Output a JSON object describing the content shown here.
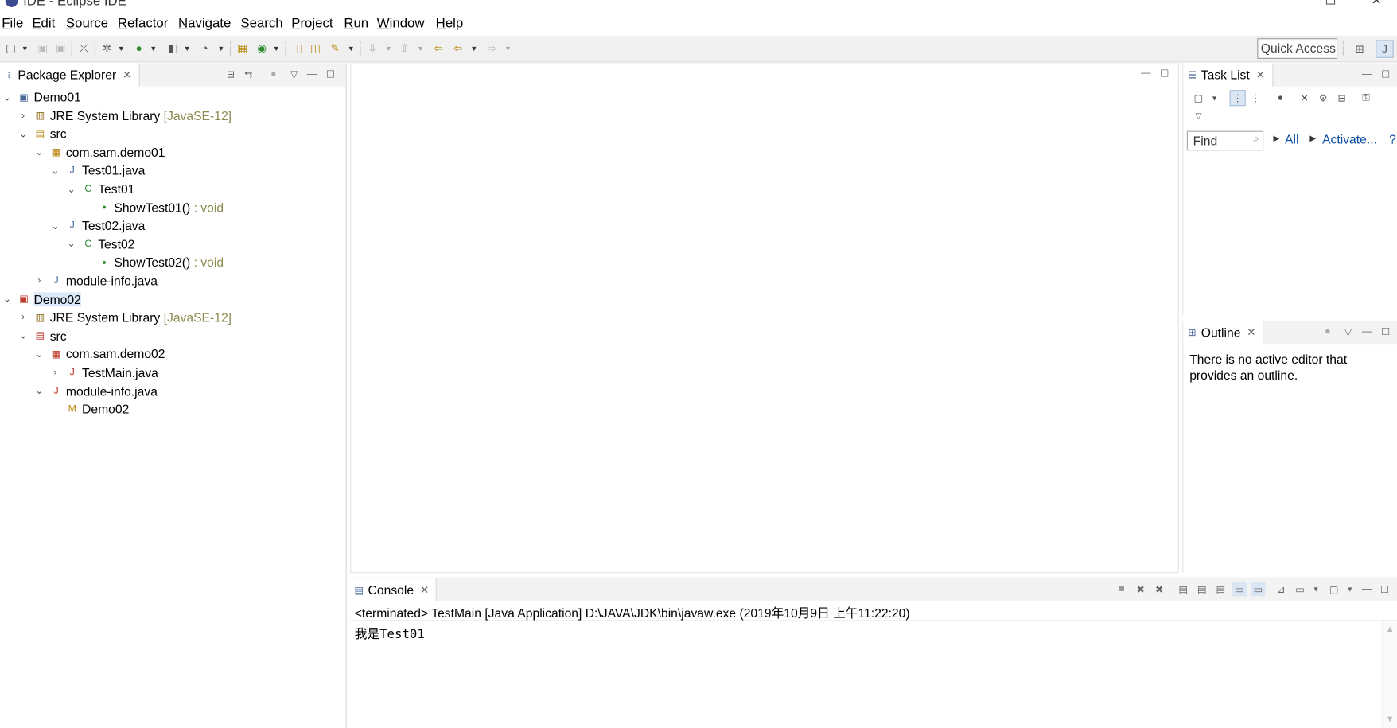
{
  "window": {
    "title": "IDE - Eclipse IDE"
  },
  "menu": [
    "File",
    "Edit",
    "Source",
    "Refactor",
    "Navigate",
    "Search",
    "Project",
    "Run",
    "Window",
    "Help"
  ],
  "toolbar": {
    "quick_access": "Quick Access"
  },
  "package_explorer": {
    "title": "Package Explorer",
    "rows": [
      {
        "label": "Demo01",
        "deco": "",
        "expand": "expanded",
        "icon": "project-icon"
      },
      {
        "label": "JRE System Library",
        "deco": " [JavaSE-12]",
        "expand": "collapsed",
        "icon": "library-icon"
      },
      {
        "label": "src",
        "deco": "",
        "expand": "expanded",
        "icon": "source-folder-icon"
      },
      {
        "label": "com.sam.demo01",
        "deco": "",
        "expand": "expanded",
        "icon": "package-icon"
      },
      {
        "label": "Test01.java",
        "deco": "",
        "expand": "expanded",
        "icon": "java-file-icon"
      },
      {
        "label": "Test01",
        "deco": "",
        "expand": "expanded",
        "icon": "class-icon"
      },
      {
        "label": "ShowTest01()",
        "deco": " : void",
        "expand": "none",
        "icon": "method-icon"
      },
      {
        "label": "Test02.java",
        "deco": "",
        "expand": "expanded",
        "icon": "java-file-icon"
      },
      {
        "label": "Test02",
        "deco": "",
        "expand": "expanded",
        "icon": "class-icon"
      },
      {
        "label": "ShowTest02()",
        "deco": " : void",
        "expand": "none",
        "icon": "method-icon"
      },
      {
        "label": "module-info.java",
        "deco": "",
        "expand": "collapsed",
        "icon": "java-file-icon"
      },
      {
        "label": "Demo02",
        "deco": "",
        "expand": "expanded",
        "icon": "project-error-icon",
        "selected": true
      },
      {
        "label": "JRE System Library",
        "deco": " [JavaSE-12]",
        "expand": "collapsed",
        "icon": "library-icon"
      },
      {
        "label": "src",
        "deco": "",
        "expand": "expanded",
        "icon": "source-folder-error-icon"
      },
      {
        "label": "com.sam.demo02",
        "deco": "",
        "expand": "expanded",
        "icon": "package-error-icon"
      },
      {
        "label": "TestMain.java",
        "deco": "",
        "expand": "collapsed",
        "icon": "java-file-error-icon"
      },
      {
        "label": "module-info.java",
        "deco": "",
        "expand": "expanded",
        "icon": "java-file-error-icon"
      },
      {
        "label": "Demo02",
        "deco": "",
        "expand": "none",
        "icon": "module-icon"
      }
    ]
  },
  "task_list": {
    "title": "Task List",
    "find_placeholder": "Find",
    "all_label": "All",
    "activate_label": "Activate...",
    "help": "?"
  },
  "outline": {
    "title": "Outline",
    "message": "There is no active editor that provides an outline."
  },
  "console": {
    "title": "Console",
    "header": "<terminated> TestMain [Java Application] D:\\JAVA\\JDK\\bin\\javaw.exe (2019年10月9日 上午11:22:20)",
    "output": "我是Test01"
  }
}
